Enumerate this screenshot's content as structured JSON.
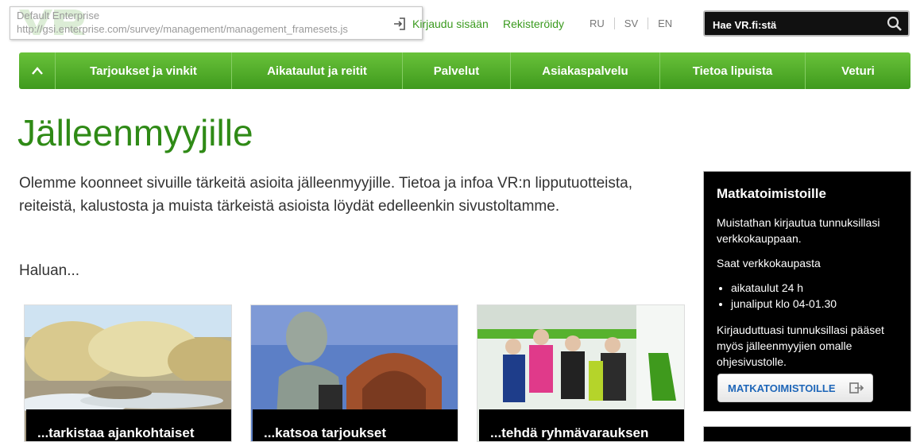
{
  "header": {
    "tooltip_line1": "Default Enterprise",
    "tooltip_line2": "http://gsi.enterprise.com/survey/management/management_framesets.js",
    "login_label": "Kirjaudu sisään",
    "register_label": "Rekisteröidy",
    "languages": [
      "RU",
      "SV",
      "EN"
    ],
    "search_placeholder": "Hae VR.fi:stä"
  },
  "nav": {
    "items": [
      "Tarjoukset ja vinkit",
      "Aikataulut ja reitit",
      "Palvelut",
      "Asiakaspalvelu",
      "Tietoa lipuista",
      "Veturi"
    ]
  },
  "main": {
    "title": "Jälleenmyyjille",
    "intro": "Olemme koonneet sivuille tärkeitä asioita jälleenmyyjille. Tietoa ja infoa VR:n lipputuotteista, reiteistä, kalustosta ja muista tärkeistä asioista löydät edelleenkin sivustoltamme.",
    "haluan": "Haluan...",
    "cards": [
      {
        "caption": "...tarkistaa ajankohtaiset"
      },
      {
        "caption": "...katsoa tarjoukset"
      },
      {
        "caption": "...tehdä ryhmävarauksen"
      }
    ]
  },
  "sidebar": {
    "title": "Matkatoimistoille",
    "p1": "Muistathan kirjautua tunnuksillasi verkkokauppaan.",
    "p2": "Saat verkkokaupasta",
    "list": [
      "aikataulut 24 h",
      "junaliput klo 04-01.30"
    ],
    "p3": "Kirjauduttuasi tunnuksillasi pääset myös jälleenmyyjien omalle ohjesivustolle.",
    "button_label": "MATKATOIMISTOILLE"
  },
  "colors": {
    "brand_green": "#3f9a1d",
    "link_blue": "#1e66b8"
  }
}
